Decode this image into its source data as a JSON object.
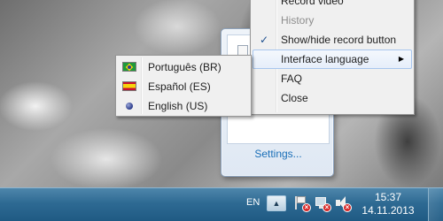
{
  "context_menu": {
    "items": [
      {
        "label": "Record video",
        "enabled": true,
        "checked": false,
        "submenu": false
      },
      {
        "label": "History",
        "enabled": false,
        "checked": false,
        "submenu": false
      },
      {
        "label": "Show/hide record button",
        "enabled": true,
        "checked": true,
        "submenu": false
      },
      {
        "label": "Interface language",
        "enabled": true,
        "checked": false,
        "submenu": true,
        "highlighted": true
      },
      {
        "label": "FAQ",
        "enabled": true,
        "checked": false,
        "submenu": false
      },
      {
        "label": "Close",
        "enabled": true,
        "checked": false,
        "submenu": false
      }
    ],
    "check_glyph": "✓",
    "submenu_arrow": "▶"
  },
  "language_menu": {
    "items": [
      {
        "label": "Português (BR)",
        "icon": "brazil-flag-icon",
        "selected": false
      },
      {
        "label": "Español (ES)",
        "icon": "spain-flag-icon",
        "selected": false
      },
      {
        "label": "English (US)",
        "icon": "radio-dot-icon",
        "selected": true
      }
    ]
  },
  "tray_popup": {
    "settings_label": "Settings..."
  },
  "taskbar": {
    "language_indicator": "EN",
    "show_hidden_icons_glyph": "▲",
    "time": "15:37",
    "date": "14.11.2013",
    "tray_icons": [
      "action-center-flag-icon",
      "network-icon",
      "volume-icon"
    ]
  },
  "colors": {
    "link": "#1a6fb8",
    "menu_background": "#f0f0f0",
    "menu_highlight_border": "#a8c6ee",
    "taskbar": "#2e6a93"
  }
}
